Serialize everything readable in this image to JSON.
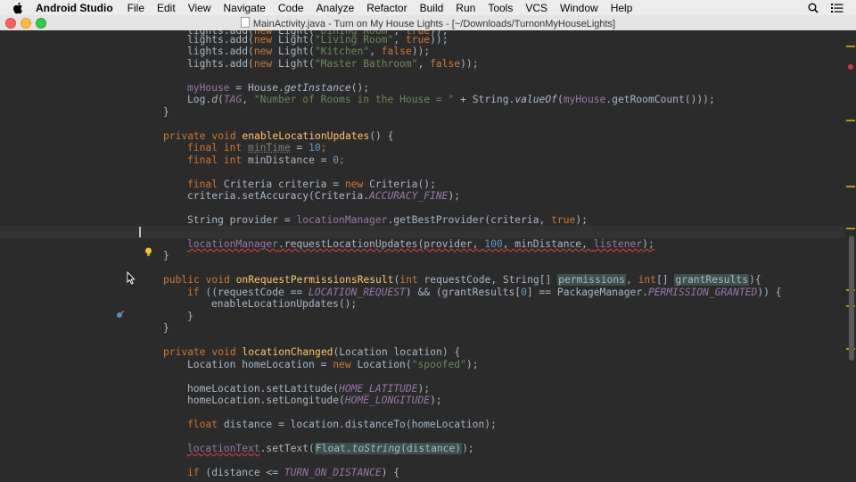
{
  "menubar": {
    "app_name": "Android Studio",
    "items": [
      "File",
      "Edit",
      "View",
      "Navigate",
      "Code",
      "Analyze",
      "Refactor",
      "Build",
      "Run",
      "Tools",
      "VCS",
      "Window",
      "Help"
    ],
    "icons": [
      "apple-icon",
      "search-icon",
      "list-icon"
    ]
  },
  "window": {
    "title": "MainActivity.java - Turn on My House Lights - [~/Downloads/TurnonMyHouseLights]"
  },
  "colors": {
    "background": "#2b2b2b",
    "keyword": "#cc7832",
    "string": "#6a8759",
    "number": "#6897bb",
    "field": "#9876aa",
    "method": "#ffc66d",
    "text": "#a9b7c6"
  },
  "code": {
    "line_0_a": "lights.add(",
    "line_0_b": "new",
    "line_0_c": " Light(",
    "line_0_d": "\"Living Room\"",
    "line_0_e": ", ",
    "line_0_f": "true",
    "line_0_g": "));",
    "line_1_a": "lights.add(",
    "line_1_b": "new",
    "line_1_c": " Light(",
    "line_1_d": "\"Kitchen\"",
    "line_1_e": ", ",
    "line_1_f": "false",
    "line_1_g": "));",
    "line_2_a": "lights.add(",
    "line_2_b": "new",
    "line_2_c": " Light(",
    "line_2_d": "\"Master Bathroom\"",
    "line_2_e": ", ",
    "line_2_f": "false",
    "line_2_g": "));",
    "line_4_a": "myHouse",
    "line_4_b": " = House.",
    "line_4_c": "getInstance",
    "line_4_d": "();",
    "line_5_a": "Log.",
    "line_5_b": "d",
    "line_5_c": "(",
    "line_5_d": "TAG",
    "line_5_e": ", ",
    "line_5_f": "\"Number of Rooms in the House = \"",
    "line_5_g": " + String.",
    "line_5_h": "valueOf",
    "line_5_i": "(",
    "line_5_j": "myHouse",
    "line_5_k": ".getRoomCount()));",
    "line_6": "}",
    "line_8_a": "private void ",
    "line_8_b": "enableLocationUpdates",
    "line_8_c": "() {",
    "line_9_a": "final int ",
    "line_9_b": "minTime",
    "line_9_c": " = ",
    "line_9_d": "10",
    "line_9_e": ";",
    "line_10_a": "final int ",
    "line_10_b": "minDistance = ",
    "line_10_c": "0",
    "line_10_d": ";",
    "line_12_a": "final ",
    "line_12_b": "Criteria criteria = ",
    "line_12_c": "new ",
    "line_12_d": "Criteria();",
    "line_13_a": "criteria.setAccuracy(Criteria.",
    "line_13_b": "ACCURACY_FINE",
    "line_13_c": ");",
    "line_15_a": "String provider = ",
    "line_15_b": "locationManager",
    "line_15_c": ".getBestProvider(criteria, ",
    "line_15_d": "true",
    "line_15_e": ");",
    "line_17_a": "locationManager",
    "line_17_b": ".requestLocationUpdates(provider, ",
    "line_17_c": "100",
    "line_17_d": ", minDistance, ",
    "line_17_e": "listener",
    "line_17_f": ");",
    "line_18": "}",
    "line_20_a": "public void ",
    "line_20_b": "onRequestPermissionsResult",
    "line_20_c": "(",
    "line_20_d": "int ",
    "line_20_e": "requestCode, String[] ",
    "line_20_f": "permissions",
    "line_20_g": ", ",
    "line_20_h": "int",
    "line_20_i": "[] ",
    "line_20_j": "grantResults",
    "line_20_k": "){",
    "line_21_a": "if ",
    "line_21_b": "((requestCode == ",
    "line_21_c": "LOCATION_REQUEST",
    "line_21_d": ") && (grantResults[",
    "line_21_e": "0",
    "line_21_f": "] == PackageManager.",
    "line_21_g": "PERMISSION_GRANTED",
    "line_21_h": ")) {",
    "line_22": "enableLocationUpdates();",
    "line_23": "}",
    "line_24": "}",
    "line_26_a": "private void ",
    "line_26_b": "locationChanged",
    "line_26_c": "(Location location) {",
    "line_27_a": "Location homeLocation = ",
    "line_27_b": "new ",
    "line_27_c": "Location(",
    "line_27_d": "\"spoofed\"",
    "line_27_e": ");",
    "line_29_a": "homeLocation.setLatitude(",
    "line_29_b": "HOME_LATITUDE",
    "line_29_c": ");",
    "line_30_a": "homeLocation.setLongitude(",
    "line_30_b": "HOME_LONGITUDE",
    "line_30_c": ");",
    "line_32_a": "float ",
    "line_32_b": "distance = location.distanceTo(homeLocation);",
    "line_34_a": "locationText",
    "line_34_b": ".setText(",
    "line_34_c": "Float.",
    "line_34_d": "toString",
    "line_34_e": "(distance)",
    "line_34_f": ");",
    "line_36_a": "if ",
    "line_36_b": "(distance <= ",
    "line_36_c": "TURN_ON_DISTANCE",
    "line_36_d": ") {"
  }
}
